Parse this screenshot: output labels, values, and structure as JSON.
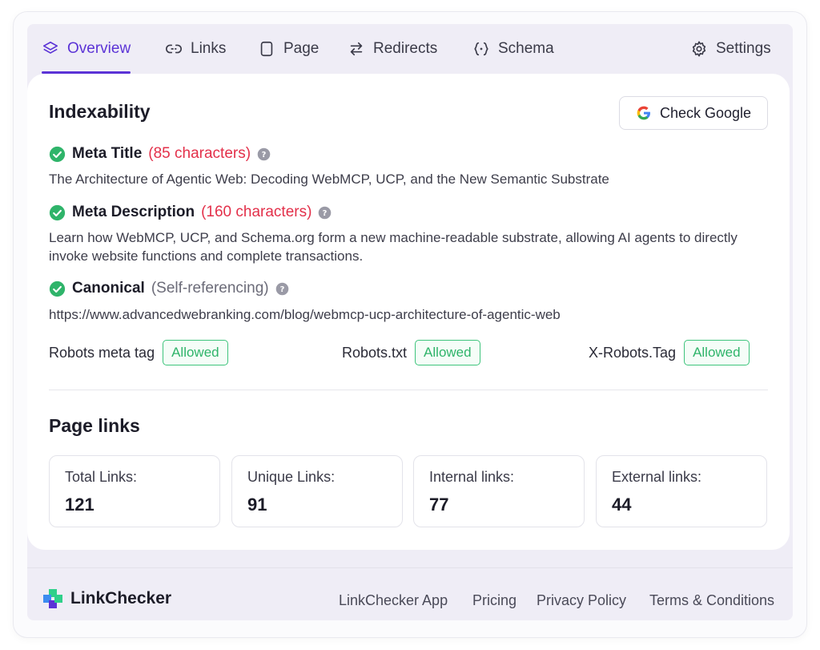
{
  "tabs": [
    {
      "label": "Overview",
      "icon": "layers-icon",
      "active": true
    },
    {
      "label": "Links",
      "icon": "link-icon"
    },
    {
      "label": "Page",
      "icon": "page-icon"
    },
    {
      "label": "Redirects",
      "icon": "redirect-arrows-icon"
    },
    {
      "label": "Schema",
      "icon": "code-braces-icon"
    },
    {
      "label": "Settings",
      "icon": "gear-icon"
    }
  ],
  "indexability": {
    "title": "Indexability",
    "check_google_label": "Check Google",
    "meta_title": {
      "label": "Meta Title",
      "count": "(85 characters)",
      "value": "The Architecture of Agentic Web: Decoding WebMCP, UCP, and the New Semantic Substrate"
    },
    "meta_description": {
      "label": "Meta Description",
      "count": "(160 characters)",
      "value": "Learn how WebMCP, UCP, and Schema.org form a new machine-readable substrate, allowing AI agents to directly invoke website functions and complete transactions."
    },
    "canonical": {
      "label": "Canonical",
      "note": "(Self-referencing)",
      "value": "https://www.advancedwebranking.com/blog/webmcp-ucp-architecture-of-agentic-web"
    },
    "robots": [
      {
        "label": "Robots meta tag",
        "status": "Allowed"
      },
      {
        "label": "Robots.txt",
        "status": "Allowed"
      },
      {
        "label": "X-Robots.Tag",
        "status": "Allowed"
      }
    ]
  },
  "page_links": {
    "title": "Page links",
    "stats": [
      {
        "label": "Total Links:",
        "value": "121"
      },
      {
        "label": "Unique Links:",
        "value": "91"
      },
      {
        "label": "Internal links:",
        "value": "77"
      },
      {
        "label": "External links:",
        "value": "44"
      }
    ]
  },
  "footer": {
    "brand": "LinkChecker",
    "links": [
      "LinkChecker App",
      "Pricing",
      "Privacy Policy",
      "Terms & Conditions"
    ]
  },
  "colors": {
    "accent": "#5b33d6",
    "success": "#2fb46a",
    "warning_red": "#e3304a"
  }
}
